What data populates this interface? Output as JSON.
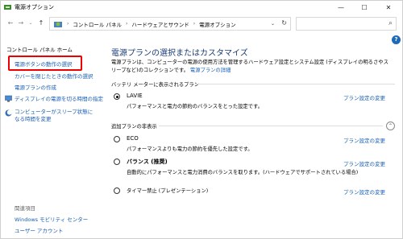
{
  "window": {
    "title": "電源オプション",
    "minimize_glyph": "—",
    "maximize_glyph": "☐",
    "close_glyph": "✕"
  },
  "nav": {
    "back_glyph": "←",
    "forward_glyph": "→",
    "history_glyph": "⌄",
    "up_glyph": "↑"
  },
  "address": {
    "crumbs": [
      "コントロール パネル",
      "ハードウェアとサウンド",
      "電源オプション"
    ],
    "separator": "›",
    "dropdown_glyph": "⌄",
    "refresh_glyph": "↻",
    "search_value": "",
    "search_glyph": "⌕"
  },
  "help_glyph": "?",
  "sidebar": {
    "home": "コントロール パネル ホーム",
    "links": [
      "電源ボタンの動作の選択",
      "カバーを閉じたときの動作の選択",
      "電源プランの作成",
      "ディスプレイの電源を切る時間の指定",
      "コンピューターがスリープ状態になる時間を変更"
    ],
    "related_heading": "関連項目",
    "related": [
      "Windows モビリティ センター",
      "ユーザー アカウント"
    ]
  },
  "main": {
    "title": "電源プランの選択またはカスタマイズ",
    "description": "電源プランは、コンピューターの電源の使用方法を管理するハードウェア設定とシステム設定 (ディスプレイの明るさやスリープなど)のコレクションです。",
    "description_link": "電源プランの詳細",
    "battery_group_label": "バッテリ メーターに表示されるプラン",
    "extra_group_label": "追加プランの非表示",
    "collapse_glyph": "⌃",
    "change_link": "プラン設定の変更",
    "plans": [
      {
        "name": "LAVIE",
        "desc": "パフォーマンスと電力の節約のバランスをとった設定です。",
        "selected": true
      },
      {
        "name": "ECO",
        "desc": "パフォーマンスよりも電力の節約を優先した設定です。",
        "selected": false
      },
      {
        "name": "バランス (推奨)",
        "desc": "自動的にパフォーマンスと電力消費のバランスを取ります。(ハードウェアでサポートされている場合)",
        "selected": false
      },
      {
        "name": "タイマー禁止 (プレゼンテーション)",
        "desc": "",
        "selected": false
      }
    ]
  },
  "colors": {
    "link": "#1a5fb4",
    "title": "#1b3c7a",
    "highlight": "#ee0000"
  }
}
